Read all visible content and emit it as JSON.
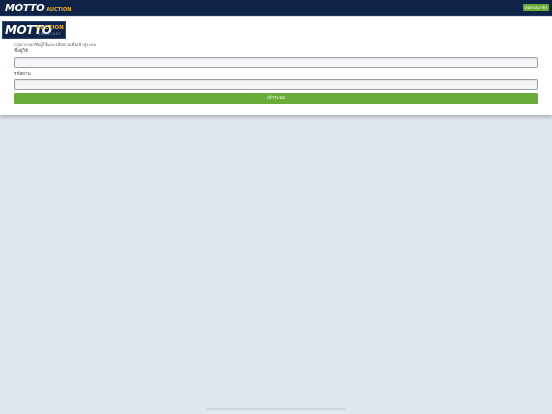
{
  "header": {
    "logo_main": "MOTTO",
    "logo_sub": "AUCTION",
    "top_button_label": "สมัครสมาชิก"
  },
  "brand": {
    "logo_main": "MOTTO",
    "logo_auction": "AUCTION",
    "logo_tagline": "SIMULCAST"
  },
  "form": {
    "instruction": "กรุณากรอกชื่อผู้ใช้และรหัสผ่านเพื่อเข้าสู่ระบบ",
    "username_label": "ชื่อผู้ใช้",
    "username_value": "",
    "password_label": "รหัสผ่าน",
    "password_value": "",
    "submit_label": "เข้าระบบ"
  },
  "colors": {
    "navbar": "#0f2346",
    "accent_gold": "#f2b31c",
    "button_green": "#6aac3a",
    "page_bg": "#e1e7ee"
  }
}
